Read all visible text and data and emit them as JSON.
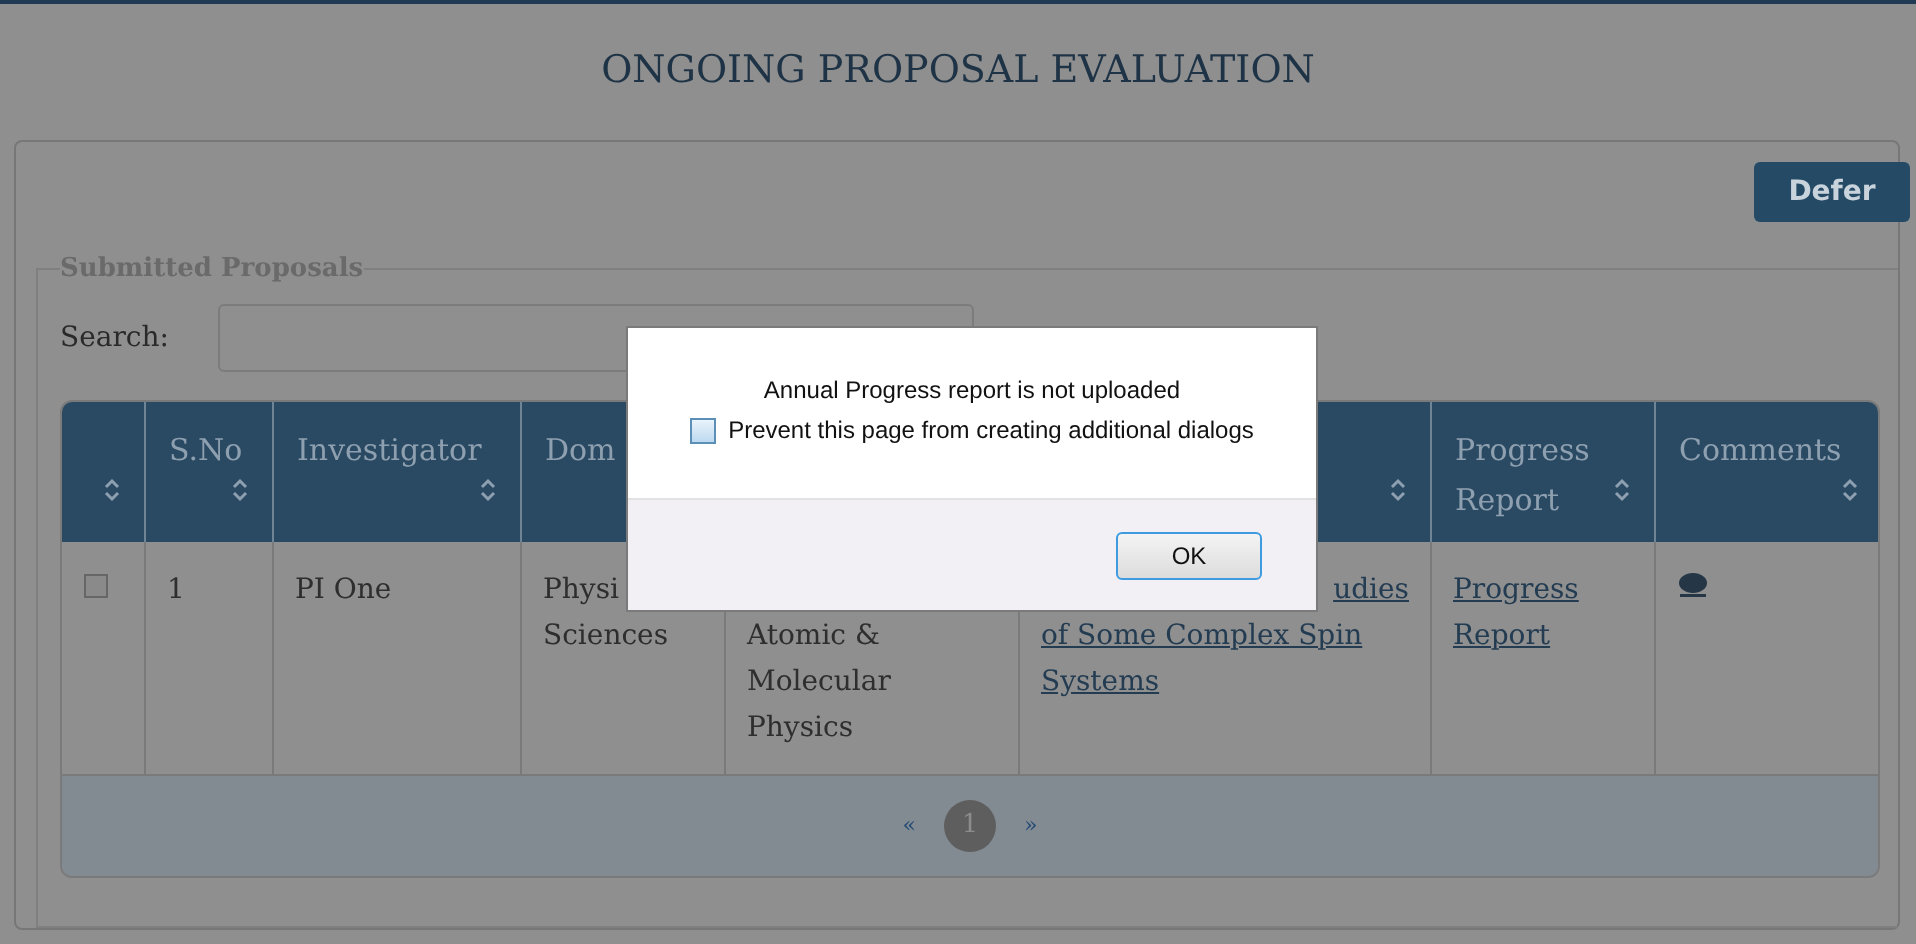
{
  "page_title": "ONGOING PROPOSAL EVALUATION",
  "defer_button": "Defer",
  "section_legend": "Submitted Proposals",
  "search": {
    "label": "Search:"
  },
  "table": {
    "columns": [
      {
        "sortable": true
      },
      {
        "label": "S.No",
        "sortable": true
      },
      {
        "label": "Investigator",
        "sortable": true
      },
      {
        "label": "Dom"
      },
      {},
      {
        "sortable": true
      },
      {
        "label": "Progress Report",
        "sortable": true
      },
      {
        "label": "Comments",
        "sortable": true
      }
    ],
    "rows": [
      {
        "cells": [
          {
            "kind": "checkbox",
            "checked": false
          },
          {
            "kind": "text",
            "lines": [
              "1"
            ]
          },
          {
            "kind": "text",
            "lines": [
              "PI One"
            ]
          },
          {
            "kind": "text",
            "lines": [
              "Physi",
              "Sciences"
            ]
          },
          {
            "kind": "text",
            "lines": [
              "Atomic &",
              "Molecular",
              "Physics"
            ]
          },
          {
            "kind": "link",
            "lines": [
              "udies",
              "of Some Complex Spin",
              "Systems"
            ]
          },
          {
            "kind": "link",
            "lines": [
              "Progress",
              "Report"
            ]
          },
          {
            "kind": "comment"
          }
        ]
      }
    ]
  },
  "pagination": {
    "prev": "«",
    "pages": [
      {
        "label": "1",
        "selected": true
      }
    ],
    "next": "»"
  },
  "dialog": {
    "message": "Annual Progress report is not uploaded",
    "checkbox": {
      "label": "Prevent this page from creating additional dialogs",
      "checked": false
    },
    "ok": "OK"
  }
}
